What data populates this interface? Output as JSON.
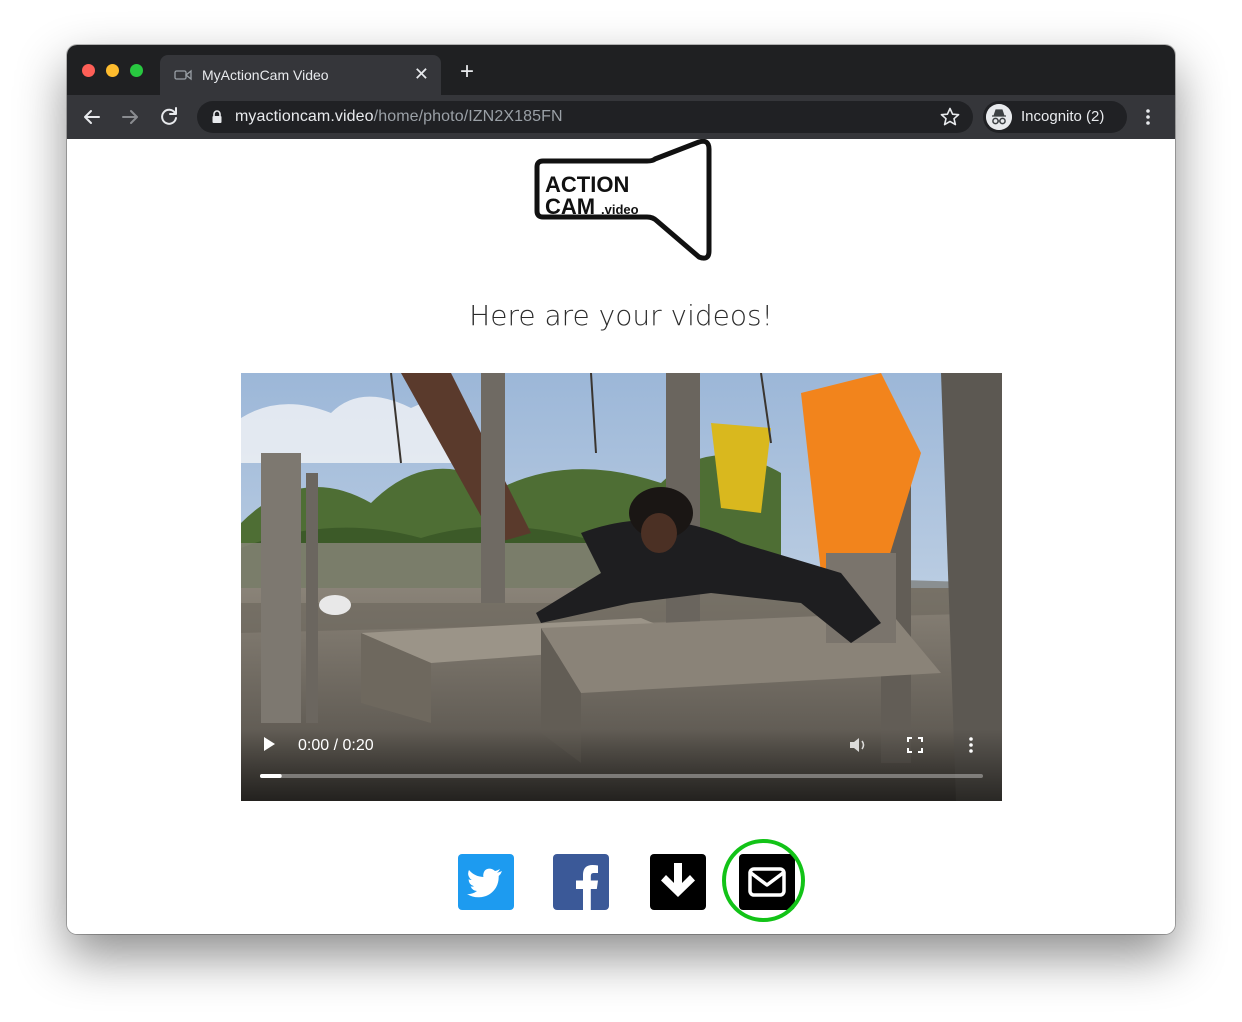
{
  "browser": {
    "tab_title": "MyActionCam Video",
    "tab_close_glyph": "✕",
    "new_tab_glyph": "+",
    "url_host": "myactioncam.video",
    "url_path": "/home/photo/IZN2X185FN",
    "incognito_label": "Incognito (2)"
  },
  "logo": {
    "line1": "ACTION",
    "line2": "CAM",
    "suffix": ".video"
  },
  "page": {
    "heading": "Here are your videos!"
  },
  "video": {
    "time": "0:00 / 0:20",
    "progress": 0.03
  },
  "share": {
    "icons": [
      "twitter-icon",
      "facebook-icon",
      "download-icon",
      "email-icon"
    ],
    "highlight_color": "#12c317"
  }
}
